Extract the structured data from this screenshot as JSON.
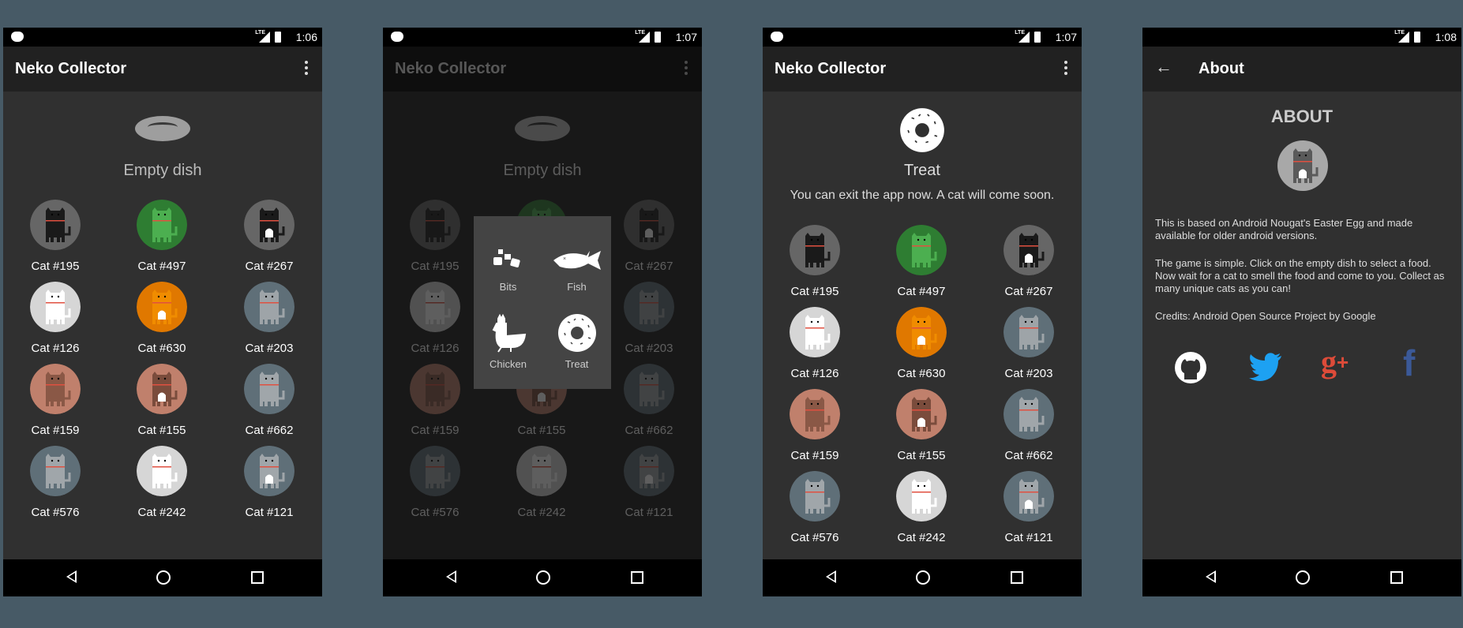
{
  "screens": [
    {
      "time": "1:06",
      "title": "Neko Collector",
      "food_label": "Empty dish"
    },
    {
      "time": "1:07",
      "title": "Neko Collector",
      "food_label": "Empty dish"
    },
    {
      "time": "1:07",
      "title": "Neko Collector",
      "food_label": "Treat",
      "message": "You can exit the app now. A cat will come soon."
    },
    {
      "time": "1:08",
      "title": "About"
    }
  ],
  "cats": [
    {
      "name": "Cat #195",
      "bg": "#666666",
      "body": "#1a1a1a",
      "belly": null
    },
    {
      "name": "Cat #497",
      "bg": "#2e7d32",
      "body": "#4caf50",
      "belly": null
    },
    {
      "name": "Cat #267",
      "bg": "#666666",
      "body": "#1a1a1a",
      "belly": "#ffffff"
    },
    {
      "name": "Cat #126",
      "bg": "#d6d6d6",
      "body": "#ffffff",
      "belly": null
    },
    {
      "name": "Cat #630",
      "bg": "#e07800",
      "body": "#f08c00",
      "belly": "#ffffff"
    },
    {
      "name": "Cat #203",
      "bg": "#5f6f78",
      "body": "#9ea4a8",
      "belly": null
    },
    {
      "name": "Cat #159",
      "bg": "#c0806c",
      "body": "#8a5846",
      "belly": null
    },
    {
      "name": "Cat #155",
      "bg": "#c0806c",
      "body": "#7a4c3c",
      "belly": "#ffffff"
    },
    {
      "name": "Cat #662",
      "bg": "#5f6f78",
      "body": "#a0a6aa",
      "belly": null
    },
    {
      "name": "Cat #576",
      "bg": "#5f6f78",
      "body": "#a0a6aa",
      "belly": null
    },
    {
      "name": "Cat #242",
      "bg": "#d6d6d6",
      "body": "#ffffff",
      "belly": null
    },
    {
      "name": "Cat #121",
      "bg": "#5f6f78",
      "body": "#a0a6aa",
      "belly": "#ffffff"
    }
  ],
  "food_menu": [
    {
      "label": "Bits",
      "icon": "bits-icon"
    },
    {
      "label": "Fish",
      "icon": "fish-icon"
    },
    {
      "label": "Chicken",
      "icon": "chicken-icon"
    },
    {
      "label": "Treat",
      "icon": "donut-icon"
    }
  ],
  "about": {
    "heading": "ABOUT",
    "paragraphs": [
      "This is based on Android Nougat's Easter Egg and made available for older android versions.",
      "The game is simple. Click on the empty dish to select a food. Now wait for a cat to smell the food and come to you. Collect as many unique cats as you can!",
      "Credits: Android Open Source Project by Google"
    ],
    "social": [
      {
        "icon": "github-icon",
        "color": "#ffffff"
      },
      {
        "icon": "twitter-icon",
        "color": "#1da1f2"
      },
      {
        "icon": "google-plus-icon",
        "color": "#dd4b39"
      },
      {
        "icon": "facebook-icon",
        "color": "#3b5998"
      }
    ]
  }
}
